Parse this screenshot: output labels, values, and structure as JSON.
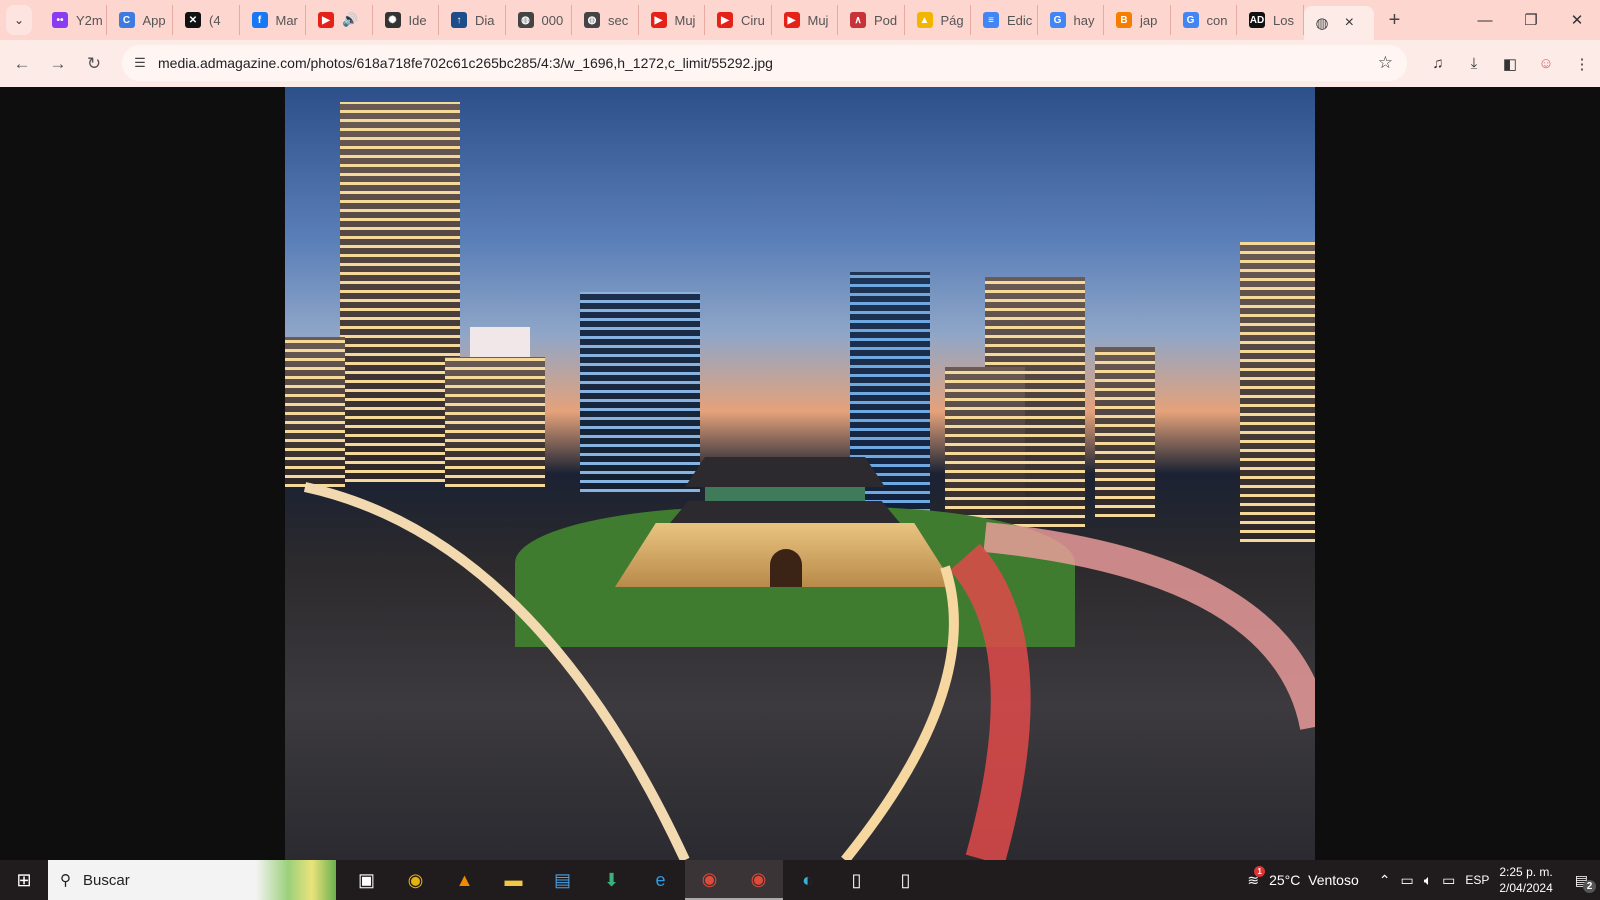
{
  "browser": {
    "tabs": [
      {
        "label": "Y2m",
        "icon": "y2mate-icon",
        "color": "#8b3cf0"
      },
      {
        "label": "App",
        "icon": "canva-icon",
        "color": "#3d7be0"
      },
      {
        "label": "(4",
        "icon": "capcut-icon",
        "color": "#111111"
      },
      {
        "label": "Mar",
        "icon": "facebook-icon",
        "color": "#1877f2"
      },
      {
        "label": "",
        "icon": "youtube-icon",
        "color": "#e62117",
        "audio": "🔊"
      },
      {
        "label": "Ide",
        "icon": "openai-icon",
        "color": "#333333"
      },
      {
        "label": "Dia",
        "icon": "diario-icon",
        "color": "#1d4e89"
      },
      {
        "label": "000",
        "icon": "globe-icon",
        "color": "#444444"
      },
      {
        "label": "sec",
        "icon": "globe-icon",
        "color": "#444444"
      },
      {
        "label": "Muj",
        "icon": "youtube-icon",
        "color": "#e62117"
      },
      {
        "label": "Ciru",
        "icon": "youtube-icon",
        "color": "#e62117"
      },
      {
        "label": "Muj",
        "icon": "youtube-icon",
        "color": "#e62117"
      },
      {
        "label": "Pod",
        "icon": "podcast-icon",
        "color": "#c8333a"
      },
      {
        "label": "Pág",
        "icon": "drive-icon",
        "color": "#f2b600"
      },
      {
        "label": "Edic",
        "icon": "docs-icon",
        "color": "#4285f4"
      },
      {
        "label": "hay",
        "icon": "google-icon",
        "color": "#4285f4"
      },
      {
        "label": "jap",
        "icon": "blogger-icon",
        "color": "#f57d00"
      },
      {
        "label": "con",
        "icon": "google-icon",
        "color": "#4285f4"
      },
      {
        "label": "Los",
        "icon": "ad-logo-icon",
        "color": "#111111"
      }
    ],
    "active_tab": {
      "icon": "globe-icon",
      "close": "×"
    },
    "new_tab": "+",
    "url": "media.admagazine.com/photos/618a718fe702c61c265bc285/4:3/w_1696,h_1272,c_limit/55292.jpg"
  },
  "taskbar": {
    "search_placeholder": "Buscar",
    "weather": "25°C  Ventoso",
    "weather_badge": "1",
    "language": "ESP",
    "time": "2:25 p. m.",
    "date": "2/04/2024",
    "notifications": "2"
  }
}
